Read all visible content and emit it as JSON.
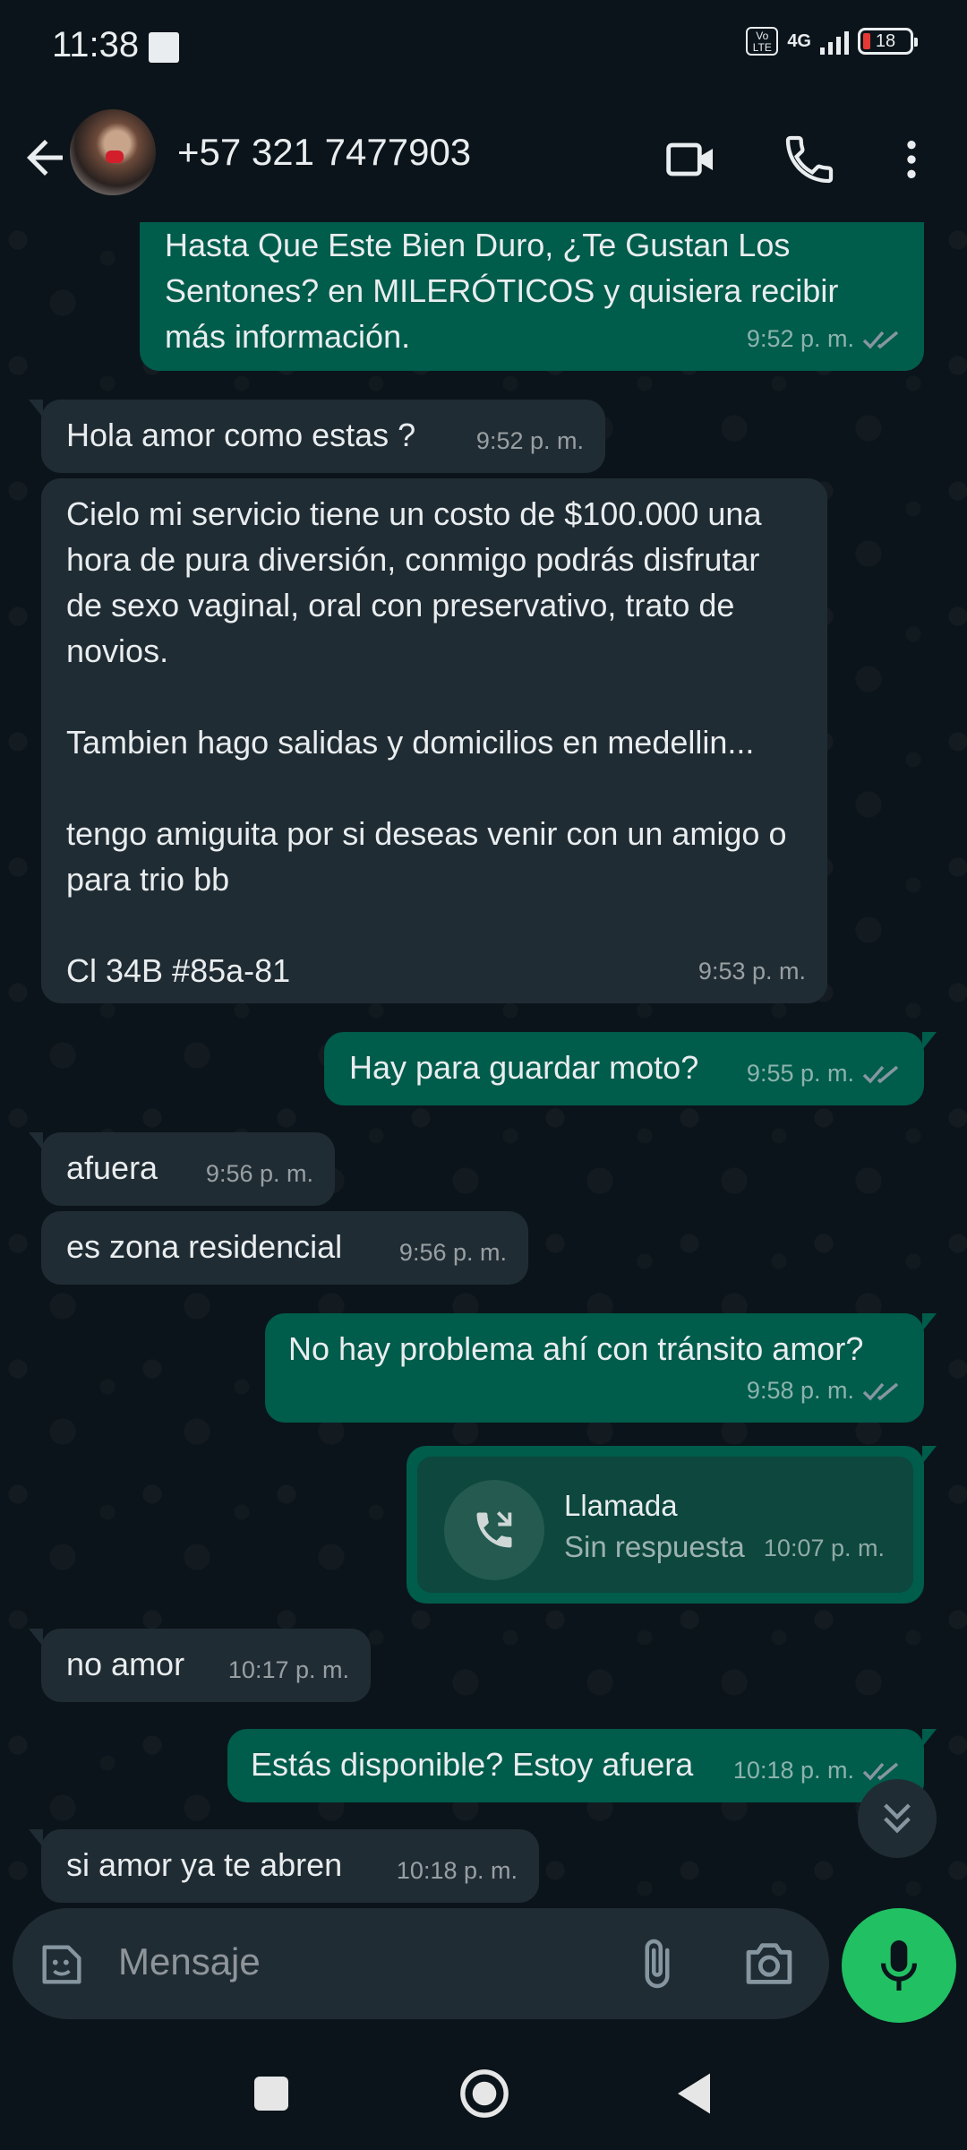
{
  "status_bar": {
    "time": "11:38",
    "network": "4G",
    "volte": "Vo\nLTE",
    "battery": "18"
  },
  "header": {
    "contact": "+57 321 7477903"
  },
  "messages": [
    {
      "dir": "out",
      "text": "Hasta Que Este Bien Duro, ¿Te Gustan Los Sentones? en MILERÓTICOS y quisiera recibir más información.",
      "time": "9:52 p. m."
    },
    {
      "dir": "in",
      "text": "Hola amor como estas ?",
      "time": "9:52 p. m."
    },
    {
      "dir": "in",
      "text": "Cielo mi servicio tiene un costo de $100.000 una hora de pura diversión, conmigo podrás disfrutar de sexo vaginal, oral con preservativo, trato de novios.\n\nTambien hago salidas y domicilios en medellin...\n\ntengo amiguita por si deseas venir con un amigo o para trio bb\n\nCl 34B #85a-81",
      "time": "9:53 p. m."
    },
    {
      "dir": "out",
      "text": "Hay para guardar moto?",
      "time": "9:55 p. m."
    },
    {
      "dir": "in",
      "text": "afuera",
      "time": "9:56 p. m."
    },
    {
      "dir": "in",
      "text": "es zona residencial",
      "time": "9:56 p. m."
    },
    {
      "dir": "out",
      "text": "No hay problema ahí con tránsito amor?",
      "time": "9:58 p. m."
    },
    {
      "dir": "in",
      "text": "no amor",
      "time": "10:17 p. m."
    },
    {
      "dir": "out",
      "text": "Estás disponible? Estoy afuera",
      "time": "10:18 p. m."
    },
    {
      "dir": "in",
      "text": "si amor ya te abren",
      "time": "10:18 p. m."
    }
  ],
  "call": {
    "title": "Llamada",
    "subtitle": "Sin respuesta",
    "time": "10:07 p. m."
  },
  "composer": {
    "placeholder": "Mensaje"
  },
  "colors": {
    "incoming": "#202c33",
    "outgoing": "#005c4b",
    "mic_button": "#21c063",
    "background": "#0b141a"
  },
  "icons": [
    "back-arrow-icon",
    "video-call-icon",
    "phone-icon",
    "more-options-icon",
    "double-check-icon",
    "missed-call-icon",
    "scroll-down-icon",
    "sticker-icon",
    "attach-icon",
    "camera-icon",
    "mic-icon"
  ]
}
